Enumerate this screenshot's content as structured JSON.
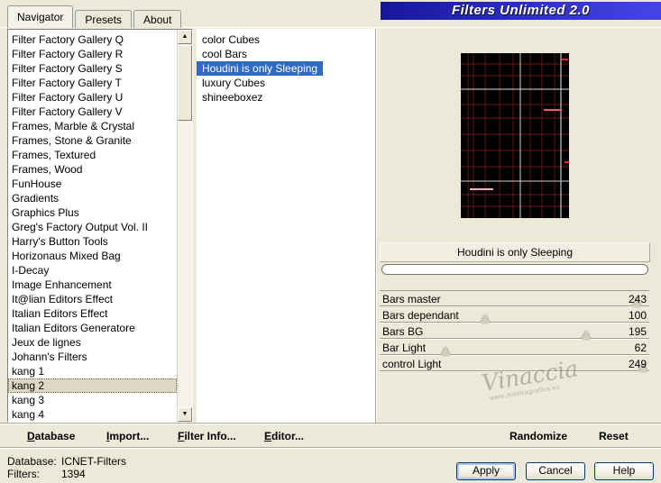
{
  "colors": {
    "dialog_bg": "#ece9d8",
    "banner_start": "#16169c",
    "banner_end": "#4545e4",
    "selection": "#316ac5"
  },
  "banner": {
    "title": "Filters Unlimited 2.0"
  },
  "tabs": [
    {
      "label": "Navigator",
      "active": true
    },
    {
      "label": "Presets",
      "active": false
    },
    {
      "label": "About",
      "active": false
    }
  ],
  "icons": {
    "scroll_up": "▲",
    "scroll_down": "▼"
  },
  "categories": {
    "selected": "kang 2",
    "items": [
      "Filter Factory Gallery Q",
      "Filter Factory Gallery R",
      "Filter Factory Gallery S",
      "Filter Factory Gallery T",
      "Filter Factory Gallery U",
      "Filter Factory Gallery V",
      "Frames, Marble & Crystal",
      "Frames, Stone & Granite",
      "Frames, Textured",
      "Frames, Wood",
      "FunHouse",
      "Gradients",
      "Graphics Plus",
      "Greg's Factory Output Vol. II",
      "Harry's Button Tools",
      "Horizonaus Mixed Bag",
      "I-Decay",
      "Image Enhancement",
      "It@lian Editors Effect",
      "Italian Editors Effect",
      "Italian Editors Generatore",
      "Jeux de lignes",
      "Johann's Filters",
      "kang 1",
      "kang 2",
      "kang 3",
      "kang 4"
    ]
  },
  "filters": {
    "selected": "Houdini is only Sleeping",
    "items": [
      "color Cubes",
      "cool Bars",
      "Houdini is only Sleeping",
      "luxury Cubes",
      "shineeboxez"
    ]
  },
  "preview": {
    "filter_name": "Houdini is only Sleeping"
  },
  "sliders": {
    "max": 255,
    "items": [
      {
        "label": "Bars master",
        "value": 243
      },
      {
        "label": "Bars dependant",
        "value": 100
      },
      {
        "label": "Bars BG",
        "value": 195
      },
      {
        "label": "Bar Light",
        "value": 62
      },
      {
        "label": "control Light",
        "value": 249
      }
    ]
  },
  "watermark": {
    "name": "Vinaccia",
    "url": "www.madiragrafica.eu"
  },
  "toolbar": {
    "database": "Database",
    "import": "Import...",
    "filter_info": "Filter Info...",
    "editor": "Editor...",
    "randomize": "Randomize",
    "reset": "Reset"
  },
  "status": {
    "database_label": "Database:",
    "database_value": "ICNET-Filters",
    "filters_label": "Filters:",
    "filters_value": "1394"
  },
  "action_buttons": {
    "apply": "Apply",
    "cancel": "Cancel",
    "help": "Help"
  }
}
